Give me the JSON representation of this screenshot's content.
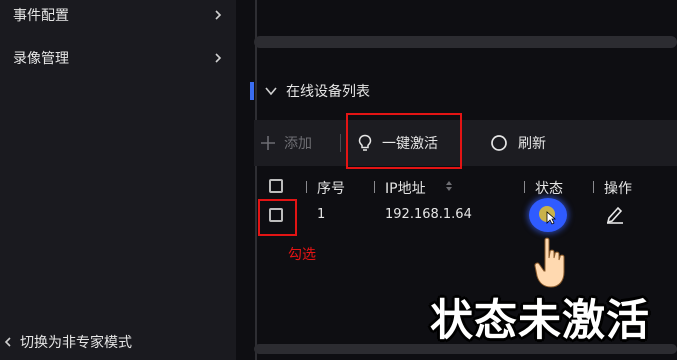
{
  "sidebar": {
    "items": [
      {
        "label": "事件配置"
      },
      {
        "label": "录像管理"
      }
    ],
    "bottom_label": "切换为非专家模式"
  },
  "section": {
    "title": "在线设备列表"
  },
  "toolbar": {
    "add_label": "添加",
    "activate_label": "一键激活",
    "refresh_label": "刷新"
  },
  "table": {
    "headers": {
      "index": "序号",
      "ip": "IP地址",
      "status": "状态",
      "action": "操作"
    },
    "rows": [
      {
        "index": "1",
        "ip": "192.168.1.64",
        "status_icon": "inactive-status-icon"
      }
    ]
  },
  "annotations": {
    "check_note": "勾选",
    "overlay_text": "状态未激活"
  },
  "colors": {
    "highlight": "#e31414",
    "accent": "#3a6df0",
    "status_glow": "#2f5bff"
  }
}
